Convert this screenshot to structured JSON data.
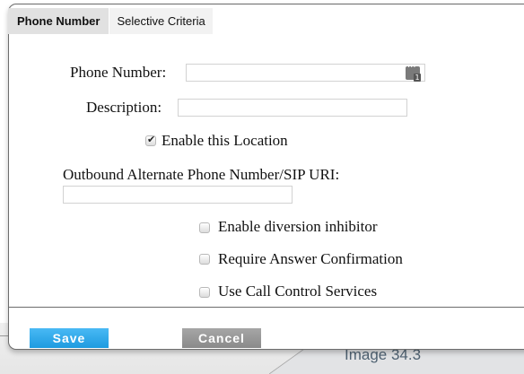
{
  "tabs": [
    {
      "label": "Phone Number",
      "active": true
    },
    {
      "label": "Selective Criteria",
      "active": false
    }
  ],
  "form": {
    "phone_number": {
      "label": "Phone Number:",
      "value": "",
      "icon": "contacts-icon"
    },
    "description": {
      "label": "Description:",
      "value": ""
    },
    "enable_location": {
      "label": "Enable this Location",
      "checked": true
    },
    "outbound_alt": {
      "label": "Outbound Alternate Phone Number/SIP URI:",
      "value": ""
    },
    "diversion_inhibitor": {
      "label": "Enable diversion inhibitor",
      "checked": false
    },
    "answer_confirmation": {
      "label": "Require Answer Confirmation",
      "checked": false
    },
    "call_control": {
      "label": "Use Call Control Services",
      "checked": false
    }
  },
  "buttons": {
    "save": "Save",
    "cancel": "Cancel"
  },
  "caption": "Image 34.3",
  "colors": {
    "save": "#2aa6ea",
    "cancel": "#999999",
    "active_tab": "#e1e1e1"
  }
}
